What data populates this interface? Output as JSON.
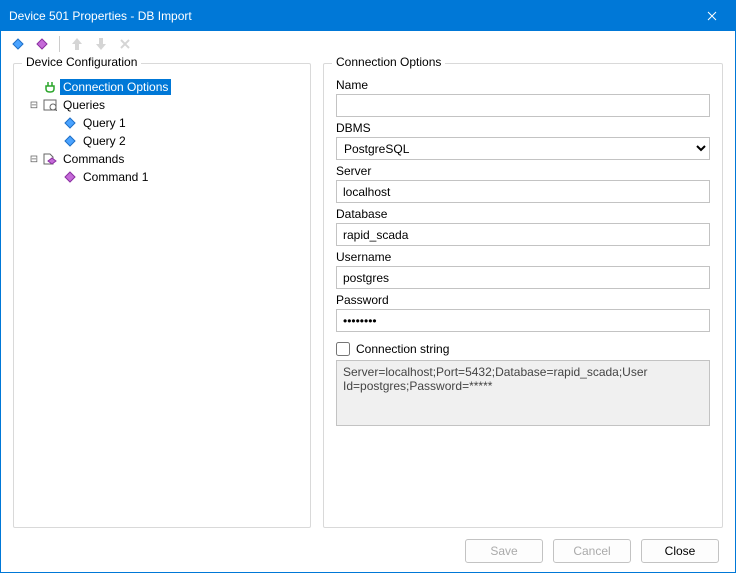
{
  "window": {
    "title": "Device 501 Properties - DB Import"
  },
  "toolbar": {
    "icons": [
      "add-query",
      "add-command",
      "move-up",
      "move-down",
      "delete"
    ]
  },
  "leftPanel": {
    "legend": "Device Configuration",
    "tree": {
      "connOptions": "Connection Options",
      "queries": "Queries",
      "query1": "Query 1",
      "query2": "Query 2",
      "commands": "Commands",
      "command1": "Command 1"
    }
  },
  "rightPanel": {
    "legend": "Connection Options",
    "labels": {
      "name": "Name",
      "dbms": "DBMS",
      "server": "Server",
      "database": "Database",
      "username": "Username",
      "password": "Password",
      "connstring": "Connection string"
    },
    "values": {
      "name": "",
      "dbms": "PostgreSQL",
      "server": "localhost",
      "database": "rapid_scada",
      "username": "postgres",
      "password": "••••••••",
      "connstring": "Server=localhost;Port=5432;Database=rapid_scada;User Id=postgres;Password=*****"
    }
  },
  "footer": {
    "save": "Save",
    "cancel": "Cancel",
    "close": "Close"
  }
}
